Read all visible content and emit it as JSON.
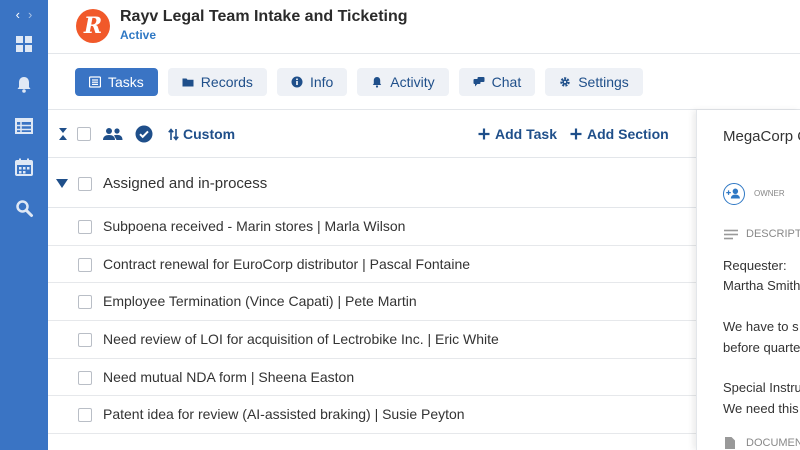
{
  "rail": {
    "icons": [
      "chevron-left-icon",
      "chevron-right-icon",
      "dashboard-icon",
      "bell-icon",
      "table-icon",
      "calendar-icon",
      "search-icon"
    ]
  },
  "header": {
    "logo_letter": "R",
    "title": "Rayv Legal Team Intake and Ticketing",
    "status": "Active"
  },
  "tabs": [
    {
      "label": "Tasks",
      "icon": "list-icon",
      "active": true
    },
    {
      "label": "Records",
      "icon": "folder-icon",
      "active": false
    },
    {
      "label": "Info",
      "icon": "info-icon",
      "active": false
    },
    {
      "label": "Activity",
      "icon": "bell-icon",
      "active": false
    },
    {
      "label": "Chat",
      "icon": "chat-icon",
      "active": false
    },
    {
      "label": "Settings",
      "icon": "gear-icon",
      "active": false
    }
  ],
  "toolbar": {
    "sort_label": "Custom",
    "add_task_label": "Add Task",
    "add_section_label": "Add Section"
  },
  "section": {
    "label": "Assigned and in-process"
  },
  "tasks": [
    "Subpoena received - Marin stores | Marla Wilson",
    "Contract renewal for EuroCorp distributor | Pascal Fontaine",
    "Employee Termination (Vince Capati) | Pete Martin",
    "Need review of LOI for acquisition of Lectrobike Inc. | Eric White",
    "Need mutual NDA form | Sheena Easton",
    "Patent idea for review (AI-assisted braking) | Susie Peyton"
  ],
  "panel": {
    "title": "MegaCorp C",
    "owner_label": "OWNER",
    "description_label": "DESCRIPT",
    "requester_label": "Requester:",
    "requester_name": "Martha Smith",
    "body_line1": "We have to s",
    "body_line2": "before quarte",
    "special_line1": "Special Instru",
    "special_line2": "We need this",
    "documents_label": "DOCUMEN"
  },
  "colors": {
    "rail": "#3a74c4",
    "accent": "#3a74c4",
    "brand_logo": "#f1592a",
    "link": "#1f4f8a"
  }
}
